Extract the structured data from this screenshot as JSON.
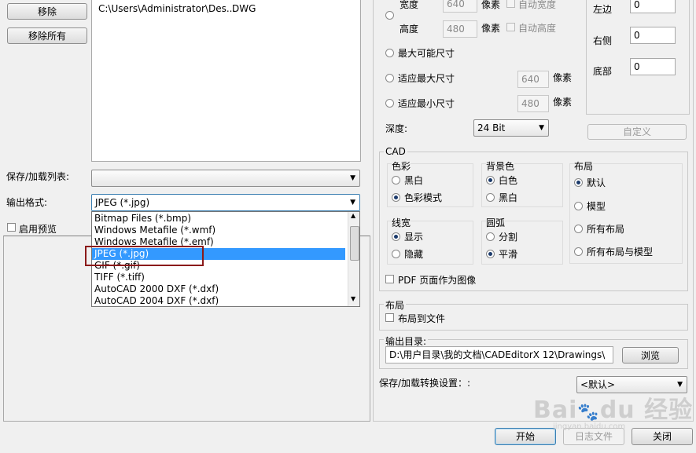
{
  "left": {
    "remove_label": "移除",
    "remove_all_label": "移除所有",
    "file_path": "C:\\Users\\Administrator\\Des...",
    "file_type": "DWG",
    "save_load_list_label": "保存/加载列表:",
    "output_format_label": "输出格式:",
    "output_format_value": "JPEG (*.jpg)",
    "preview_label": "启用预览",
    "format_options": [
      "Bitmap Files (*.bmp)",
      "Windows Metafile (*.wmf)",
      "Windows Metafile (*.emf)",
      "JPEG (*.jpg)",
      "GIF (*.gif)",
      "TIFF (*.tiff)",
      "AutoCAD 2000 DXF (*.dxf)",
      "AutoCAD 2004 DXF (*.dxf)"
    ]
  },
  "size": {
    "width_label": "宽度",
    "width_value": "640",
    "height_label": "高度",
    "height_value": "480",
    "pixel_unit": "像素",
    "auto_width_label": "自动宽度",
    "auto_height_label": "自动高度",
    "max_possible_label": "最大可能尺寸",
    "fit_max_label": "适应最大尺寸",
    "fit_max_value": "640",
    "fit_min_label": "适应最小尺寸",
    "fit_min_value": "480",
    "depth_label": "深度:",
    "depth_value": "24 Bit"
  },
  "margins": {
    "left_label": "左边",
    "left_value": "0",
    "right_label": "右侧",
    "right_value": "0",
    "bottom_label": "底部",
    "bottom_value": "0",
    "custom_label": "自定义"
  },
  "cad": {
    "title": "CAD",
    "color_title": "色彩",
    "black_white": "黑白",
    "color_mode": "色彩模式",
    "bg_title": "背景色",
    "bg_white": "白色",
    "bg_black": "黑白",
    "layout_title": "布局",
    "layout_default": "默认",
    "layout_model": "模型",
    "layout_all": "所有布局",
    "layout_all_model": "所有布局与模型",
    "linewidth_title": "线宽",
    "lw_show": "显示",
    "lw_hide": "隐藏",
    "arc_title": "圆弧",
    "arc_segment": "分割",
    "arc_smooth": "平滑",
    "pdf_as_image": "PDF 页面作为图像"
  },
  "layout_section": {
    "title": "布局",
    "layout_to_file": "布局到文件"
  },
  "output": {
    "dir_label": "输出目录:",
    "dir_value": "D:\\用户目录\\我的文档\\CADEditorX 12\\Drawings\\",
    "browse_label": "浏览",
    "convert_settings_label": "保存/加载转换设置：:",
    "convert_settings_value": "<默认>"
  },
  "bottom": {
    "start_label": "开始",
    "log_label": "日志文件",
    "close_label": "关闭"
  },
  "colors": {
    "selection": "#3399ff",
    "highlight_box": "#8b1a1a"
  }
}
